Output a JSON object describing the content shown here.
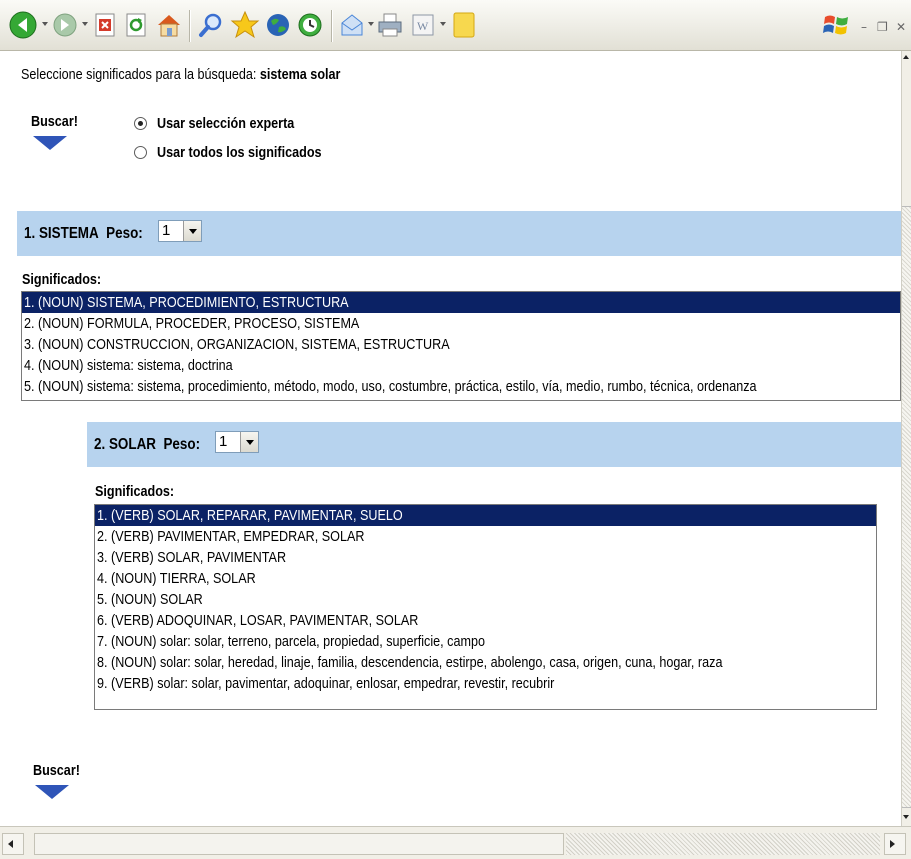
{
  "toolbar": {
    "buttons": [
      {
        "name": "back-icon",
        "color": "#2e9a2e"
      },
      {
        "name": "forward-icon",
        "color": "#8fb98f"
      },
      {
        "name": "stop-icon",
        "color": "#d43a2a"
      },
      {
        "name": "refresh-icon",
        "color": "#2e9a2e"
      },
      {
        "name": "home-icon",
        "color": "#e07d2a"
      },
      {
        "name": "search-icon",
        "color": "#3b6fd0"
      },
      {
        "name": "favorites-icon",
        "color": "#f2c200"
      },
      {
        "name": "media-icon",
        "color": "#1f5aa6"
      },
      {
        "name": "history-icon",
        "color": "#2e9a2e"
      },
      {
        "name": "mail-icon",
        "color": "#4a86d8"
      },
      {
        "name": "print-icon",
        "color": "#6b7c8f"
      },
      {
        "name": "edit-word-icon",
        "color": "#7a8aa3"
      },
      {
        "name": "messenger-icon",
        "color": "#f5cf3a"
      }
    ],
    "window_controls": {
      "minimize": "–",
      "restore": "❐",
      "close": "✕"
    }
  },
  "page": {
    "intro_text": "Seleccione significados para la búsqueda:",
    "query": "sistema solar",
    "buscar_label": "Buscar!",
    "radio_options": [
      {
        "label": "Usar selección experta",
        "checked": true
      },
      {
        "label": "Usar todos los significados",
        "checked": false
      }
    ],
    "significados_label": "Significados:",
    "peso_label": "Peso:",
    "terms": [
      {
        "title": "1. SISTEMA",
        "peso": "1",
        "meanings": [
          "1. (NOUN) SISTEMA, PROCEDIMIENTO, ESTRUCTURA",
          "2. (NOUN) FORMULA, PROCEDER, PROCESO, SISTEMA",
          "3. (NOUN) CONSTRUCCION, ORGANIZACION, SISTEMA, ESTRUCTURA",
          "4. (NOUN) sistema: sistema, doctrina",
          "5. (NOUN) sistema: sistema, procedimiento, método, modo, uso, costumbre, práctica, estilo, vía, medio, rumbo, técnica, ordenanza"
        ],
        "selected_index": 0
      },
      {
        "title": "2. SOLAR",
        "peso": "1",
        "meanings": [
          "1. (VERB) SOLAR, REPARAR, PAVIMENTAR, SUELO",
          "2. (VERB) PAVIMENTAR, EMPEDRAR, SOLAR",
          "3. (VERB) SOLAR, PAVIMENTAR",
          "4. (NOUN) TIERRA, SOLAR",
          "5. (NOUN) SOLAR",
          "6. (VERB) ADOQUINAR, LOSAR, PAVIMENTAR, SOLAR",
          "7. (NOUN) solar: solar, terreno, parcela, propiedad, superficie, campo",
          "8. (NOUN) solar: solar, heredad, linaje, familia, descendencia, estirpe, abolengo, casa, origen, cuna, hogar, raza",
          "9. (VERB) solar: solar, pavimentar, adoquinar, enlosar, empedrar, revestir, recubrir"
        ],
        "selected_index": 0
      }
    ]
  },
  "colors": {
    "band": "#b7d3ee",
    "selection": "#0b2265",
    "buscar_arrow": "#2f55b8"
  }
}
